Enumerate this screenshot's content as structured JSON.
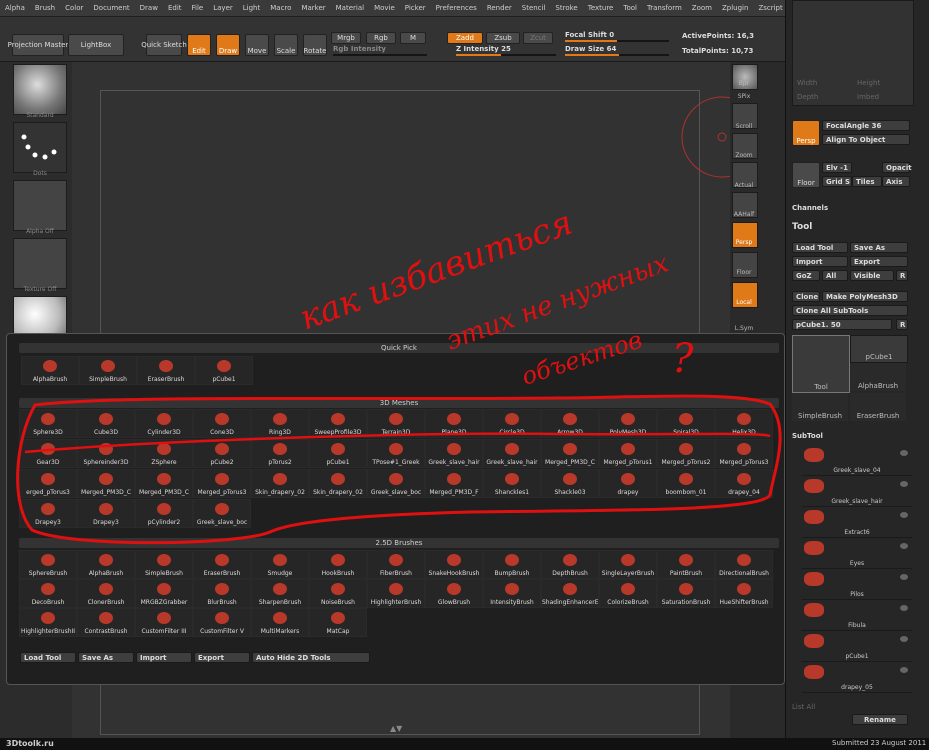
{
  "menu": [
    "Alpha",
    "Brush",
    "Color",
    "Document",
    "Draw",
    "Edit",
    "File",
    "Layer",
    "Light",
    "Macro",
    "Marker",
    "Material",
    "Movie",
    "Picker",
    "Preferences",
    "Render",
    "Stencil",
    "Stroke",
    "Texture",
    "Tool",
    "Transform",
    "Zoom",
    "Zplugin",
    "Zscript"
  ],
  "toolbar": {
    "projection_master": "Projection Master",
    "lightbox": "LightBox",
    "quick_sketch": "Quick Sketch",
    "edit": "Edit",
    "draw": "Draw",
    "move": "Move",
    "scale": "Scale",
    "rotate": "Rotate",
    "mrgb": "Mrgb",
    "rgb": "Rgb",
    "m": "M",
    "rgb_intensity": "Rgb Intensity",
    "zadd": "Zadd",
    "zsub": "Zsub",
    "zcut": "Zcut",
    "z_intensity": "Z Intensity 25",
    "focal_shift": "Focal Shift 0",
    "draw_size": "Draw Size 64",
    "active_points": "ActivePoints: 16,3",
    "total_points": "TotalPoints: 10,73"
  },
  "left": {
    "standard": "Standard",
    "dots": "Dots",
    "alpha_off": "Alpha Off",
    "texture_off": "Texture Off"
  },
  "right_strip": [
    "Bpr",
    "SPix",
    "Scroll",
    "Zoom",
    "Actual",
    "AAHalf",
    "Persp",
    "Floor",
    "Local",
    "L.Sym"
  ],
  "right_panel": {
    "width": "Width",
    "height": "Height",
    "depth": "Depth",
    "imbed": "Imbed",
    "persp": "Persp",
    "focal_angle": "FocalAngle 36",
    "align_to_object": "Align To Object",
    "floor": "Floor",
    "elv": "Elv -1",
    "grid": "Grid S",
    "tiles": "Tiles",
    "opacity": "Opacit",
    "axis": "Axis",
    "channels": "Channels",
    "tool_title": "Tool",
    "load_tool": "Load Tool",
    "save_as": "Save As",
    "import": "Import",
    "export": "Export",
    "goz": "GoZ",
    "all": "All",
    "visible": "Visible",
    "r": "R",
    "clone": "Clone",
    "make_polymesh": "Make PolyMesh3D",
    "clone_all_subtools": "Clone All SubTools",
    "current_tool": "pCube1. 50",
    "tool_thumbs": [
      "Tool",
      "pCube1",
      "AlphaBrush",
      "SimpleBrush",
      "EraserBrush"
    ],
    "subtool_title": "SubTool",
    "subtools": [
      "Greek_slave_04",
      "Greek_slave_hair",
      "Extract6",
      "Eyes",
      "Pilos",
      "Fibula",
      "pCube1",
      "drapey_05"
    ],
    "list_all": "List All",
    "rename": "Rename"
  },
  "popup": {
    "quick_pick": "Quick Pick",
    "quick_items": [
      "AlphaBrush",
      "SimpleBrush",
      "EraserBrush",
      "pCube1"
    ],
    "meshes_title": "3D Meshes",
    "meshes": [
      "Sphere3D",
      "Cube3D",
      "Cylinder3D",
      "Cone3D",
      "Ring3D",
      "SweepProfile3D",
      "Terrain3D",
      "Plane3D",
      "Circle3D",
      "Arrow3D",
      "PolyMesh3D",
      "Spiral3D",
      "Helix3D",
      "Gear3D",
      "Sphereinder3D",
      "ZSphere",
      "pCube2",
      "pTorus2",
      "pCube1",
      "TPose#1_Greek",
      "Greek_slave_hair",
      "Greek_slave_hair",
      "Merged_PM3D_C",
      "Merged_pTorus1",
      "Merged_pTorus2",
      "Merged_pTorus3",
      "erged_pTorus3",
      "Merged_PM3D_C",
      "Merged_PM3D_C",
      "Merged_pTorus3",
      "Skin_drapery_02",
      "Skin_drapery_02",
      "Greek_slave_boc",
      "Merged_PM3D_F",
      "Shanckles1",
      "Shackle03",
      "drapey",
      "boombom_01",
      "drapey_04",
      "Drapey3",
      "Drapey3",
      "pCylinder2",
      "Greek_slave_boc"
    ],
    "brushes_title": "2.5D Brushes",
    "brushes": [
      "SphereBrush",
      "AlphaBrush",
      "SimpleBrush",
      "EraserBrush",
      "Smudge",
      "HookBrush",
      "FiberBrush",
      "SnakeHookBrush",
      "BumpBrush",
      "DepthBrush",
      "SingleLayerBrush",
      "PaintBrush",
      "DirectionalBrush",
      "DecoBrush",
      "ClonerBrush",
      "MRGBZGrabber",
      "BlurBrush",
      "SharpenBrush",
      "NoiseBrush",
      "HighlighterBrush",
      "GlowBrush",
      "IntensityBrush",
      "ShadingEnhancerE",
      "ColorizeBrush",
      "SaturationBrush",
      "HueShifterBrush",
      "HighlighterBrushII",
      "ContrastBrush",
      "CustomFilter III",
      "CustomFilter V",
      "MultiMarkers",
      "MatCap"
    ],
    "footer": {
      "load_tool": "Load Tool",
      "save_as": "Save As",
      "import": "Import",
      "export": "Export",
      "auto_hide": "Auto Hide 2D Tools"
    }
  },
  "annotation": {
    "line1": "как избавиться",
    "line2": "этих не нужных",
    "line3": "объектов",
    "mark": "?"
  },
  "status": {
    "site": "3Dtoolk.ru",
    "submitted": "Submitted 23 August 2011"
  },
  "colors": {
    "accent": "#e07a18",
    "ink": "#e01010"
  }
}
